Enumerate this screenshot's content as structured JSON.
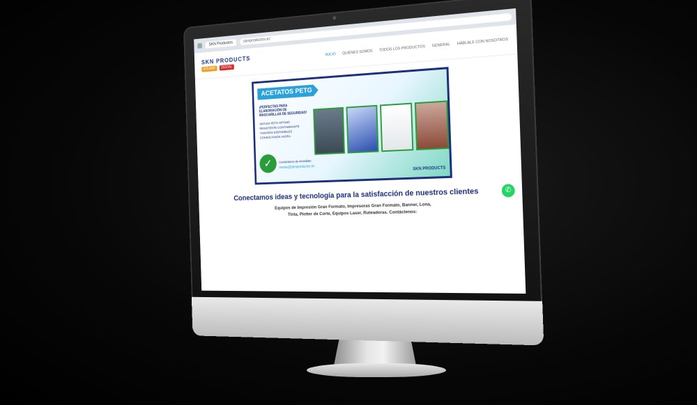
{
  "browser": {
    "tab_label": "SKN Productos",
    "url": "skmproductos.ec"
  },
  "site": {
    "logo_text": "SKN PRODUCTS",
    "partners": [
      {
        "label": "ROLAND"
      },
      {
        "label": "DIGITAL"
      }
    ],
    "nav": [
      {
        "label": "INICIO"
      },
      {
        "label": "QUIÉNES SOMOS"
      },
      {
        "label": "TODOS LOS PRODUCTOS"
      },
      {
        "label": "GENERAL"
      },
      {
        "label": "HÁBLALE CON NOSOTROS"
      }
    ]
  },
  "banner": {
    "title": "ACETATOS PETG",
    "subtitle": "¡PERFECTAS PARA ELABORACIÓN DE MASCARILLAS DE SEGURIDAD!",
    "bullets": [
      "SKFLEX PETG OPTIMO",
      "RESISTENTE CONTAMINANTE",
      "TAMAÑOS DISPONIBLES",
      "CONSÚLTANOS AHORA"
    ],
    "contact_label": "Contáctanos de inmediato",
    "email": "ventas@skmproductos.ec",
    "brand": "SKN PRODUCTS"
  },
  "headline": "Conectamos ideas y tecnología para la satisfacción de nuestros clientes",
  "description": "Equipos de Impresión Gran Formato, Impresoras Gran Formato, Banner, Lona, Tinta, Plotter de Corte, Equipos Laser, Ruteadoras. Contáctenos:",
  "whatsapp_icon": "whatsapp-icon"
}
